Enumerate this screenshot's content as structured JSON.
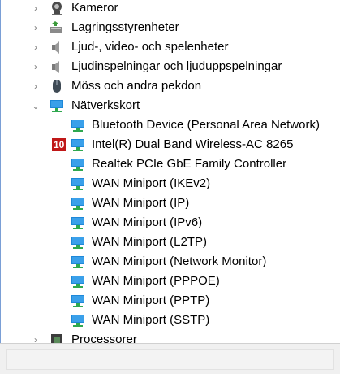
{
  "categories": [
    {
      "label": "Kameror",
      "icon": "camera-icon",
      "expanded": false
    },
    {
      "label": "Lagringsstyrenheter",
      "icon": "storage-controller-icon",
      "expanded": false
    },
    {
      "label": "Ljud-, video- och spelenheter",
      "icon": "speaker-icon",
      "expanded": false
    },
    {
      "label": "Ljudinspelningar och ljuduppspelningar",
      "icon": "speaker-icon",
      "expanded": false
    },
    {
      "label": "Möss och andra pekdon",
      "icon": "mouse-icon",
      "expanded": false
    },
    {
      "label": "Nätverkskort",
      "icon": "network-adapter-icon",
      "expanded": true
    }
  ],
  "network_adapters": [
    "Bluetooth Device (Personal Area Network)",
    "Intel(R) Dual Band Wireless-AC 8265",
    "Realtek PCIe GbE Family Controller",
    "WAN Miniport (IKEv2)",
    "WAN Miniport (IP)",
    "WAN Miniport (IPv6)",
    "WAN Miniport (L2TP)",
    "WAN Miniport (Network Monitor)",
    "WAN Miniport (PPPOE)",
    "WAN Miniport (PPTP)",
    "WAN Miniport (SSTP)"
  ],
  "marker": {
    "label": "10"
  },
  "next_category": {
    "label": "Processorer",
    "icon": "processor-icon"
  },
  "colors": {
    "badge": "#c01818",
    "network_icon": "#1e88d8",
    "network_base": "#2fa84f"
  }
}
